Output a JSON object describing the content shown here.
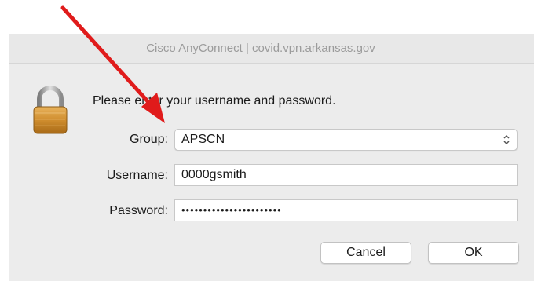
{
  "window": {
    "title": "Cisco AnyConnect | covid.vpn.arkansas.gov"
  },
  "prompt": "Please enter your username and password.",
  "form": {
    "group": {
      "label": "Group:",
      "value": "APSCN"
    },
    "username": {
      "label": "Username:",
      "value": "0000gsmith"
    },
    "password": {
      "label": "Password:",
      "masked_value": "•••••••••••••••••••••••"
    }
  },
  "buttons": {
    "cancel": "Cancel",
    "ok": "OK"
  },
  "icons": {
    "lock": "padlock-icon",
    "stepper": "up-down-stepper-icon",
    "annotation": "red-arrow-annotation"
  },
  "colors": {
    "annotation": "#e01b1b",
    "window_bg": "#ececec",
    "title_text": "#9b9b9b"
  }
}
